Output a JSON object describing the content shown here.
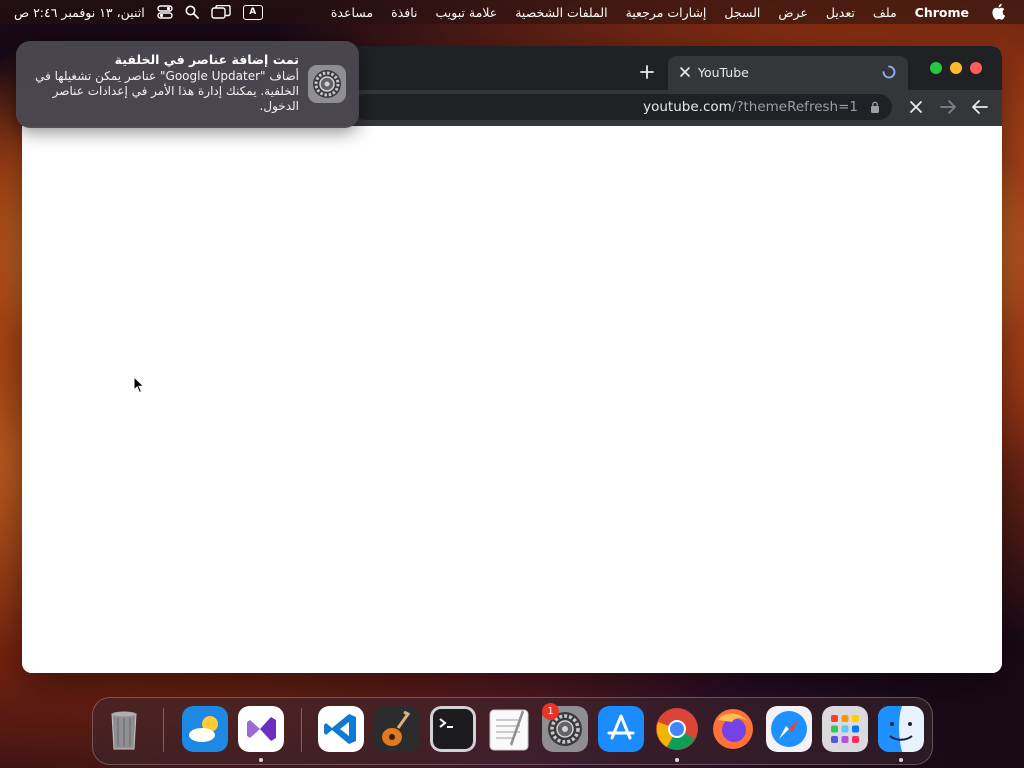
{
  "menubar": {
    "app_name": "Chrome",
    "menus": [
      "ملف",
      "تعديل",
      "عرض",
      "السجل",
      "إشارات مرجعية",
      "الملفات الشخصية",
      "علامة تبويب",
      "نافذة",
      "مساعدة"
    ],
    "clock": "اثنين، ١٣ نوفمبر ٢:٤٦ ص",
    "input_indicator": "A",
    "icons": [
      "apple-icon",
      "keyboard-input-icon",
      "screen-mirroring-icon",
      "search-icon",
      "control-center-icon"
    ]
  },
  "browser": {
    "tab_title": "YouTube",
    "url_host": "youtube.com",
    "url_path": "/?themeRefresh=1",
    "traffic_light_colors": {
      "close": "#ff5f57",
      "minimize": "#febc2e",
      "maximize": "#28c840"
    }
  },
  "notification": {
    "title": "تمت إضافة عناصر في الخلفية",
    "body": "أضاف \"Google Updater\" عناصر يمكن تشغيلها في الخلفية. يمكنك إدارة هذا الأمر في إعدادات عناصر الدخول."
  },
  "dock": {
    "items": [
      {
        "name": "trash-icon"
      },
      {
        "name": "weather-icon"
      },
      {
        "name": "visual-studio-icon"
      },
      {
        "name": "vscode-icon"
      },
      {
        "name": "garageband-icon"
      },
      {
        "name": "terminal-icon"
      },
      {
        "name": "textedit-icon"
      },
      {
        "name": "system-settings-icon",
        "badge": "1"
      },
      {
        "name": "app-store-icon"
      },
      {
        "name": "chrome-icon"
      },
      {
        "name": "firefox-icon"
      },
      {
        "name": "safari-icon"
      },
      {
        "name": "launchpad-icon"
      },
      {
        "name": "finder-icon"
      }
    ]
  }
}
